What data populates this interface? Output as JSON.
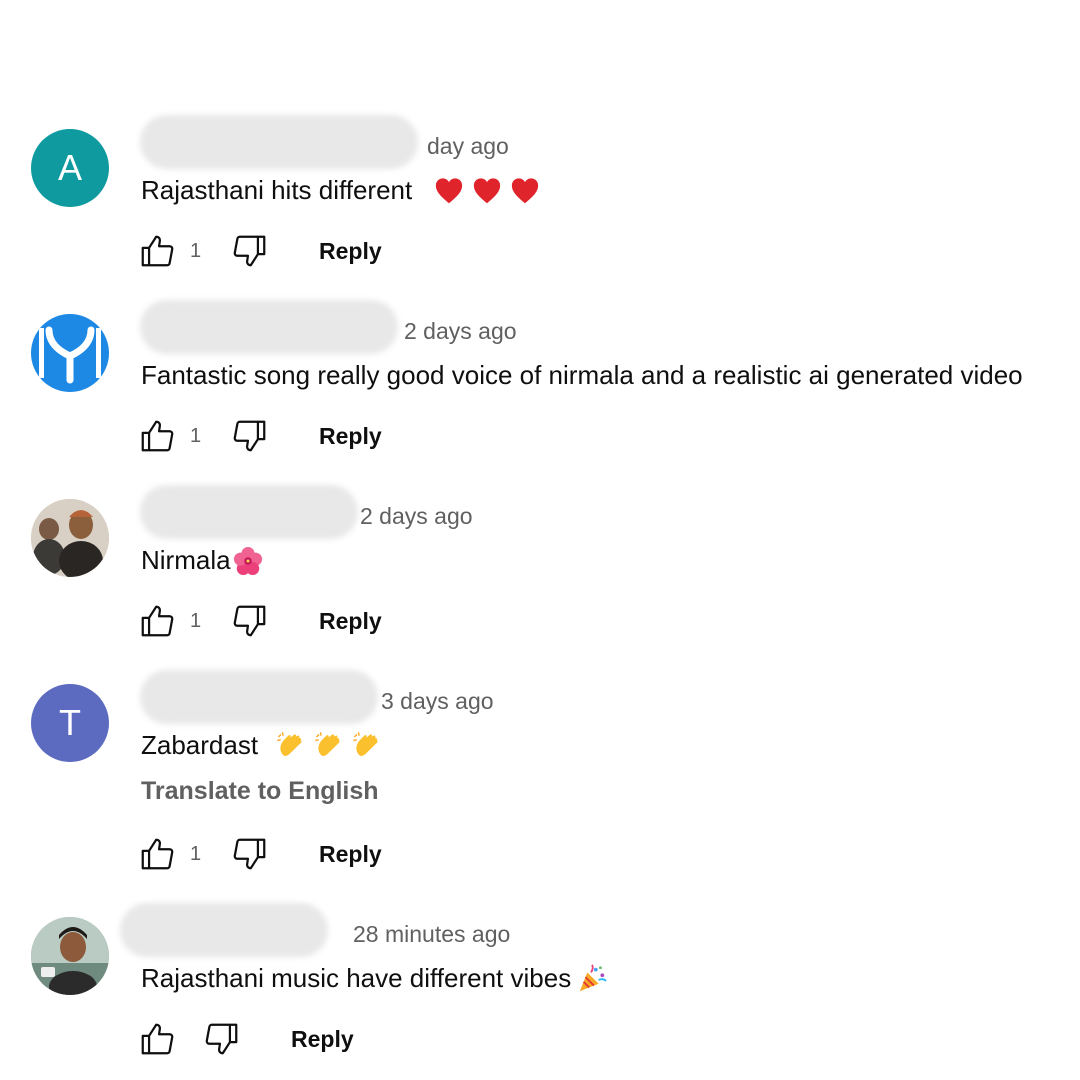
{
  "comments": [
    {
      "avatar_letter": "A",
      "avatar_color": "#0f9aa0",
      "timestamp": "day ago",
      "text": "Rajasthani hits different",
      "emojis": [
        "red-heart",
        "red-heart",
        "red-heart"
      ],
      "likes": "1",
      "reply_label": "Reply"
    },
    {
      "avatar_letter": "",
      "avatar_color": "#1e88e5",
      "timestamp": "2 days ago",
      "text": "Fantastic song really good voice of nirmala and a realistic ai generated video",
      "emojis": [],
      "likes": "1",
      "reply_label": "Reply"
    },
    {
      "avatar_letter": "",
      "avatar_color": "#9a7c66",
      "timestamp": "2 days ago",
      "text": "Nirmala",
      "emojis": [
        "hibiscus"
      ],
      "likes": "1",
      "reply_label": "Reply"
    },
    {
      "avatar_letter": "T",
      "avatar_color": "#5c6bc0",
      "timestamp": "3 days ago",
      "text": "Zabardast",
      "emojis": [
        "clapping-hands",
        "clapping-hands",
        "clapping-hands"
      ],
      "translate_label": "Translate to English",
      "likes": "1",
      "reply_label": "Reply"
    },
    {
      "avatar_letter": "",
      "avatar_color": "#8aa39a",
      "timestamp": "28 minutes ago",
      "text": "Rajasthani music have different vibes",
      "emojis": [
        "party-popper"
      ],
      "likes": "",
      "reply_label": "Reply"
    }
  ]
}
